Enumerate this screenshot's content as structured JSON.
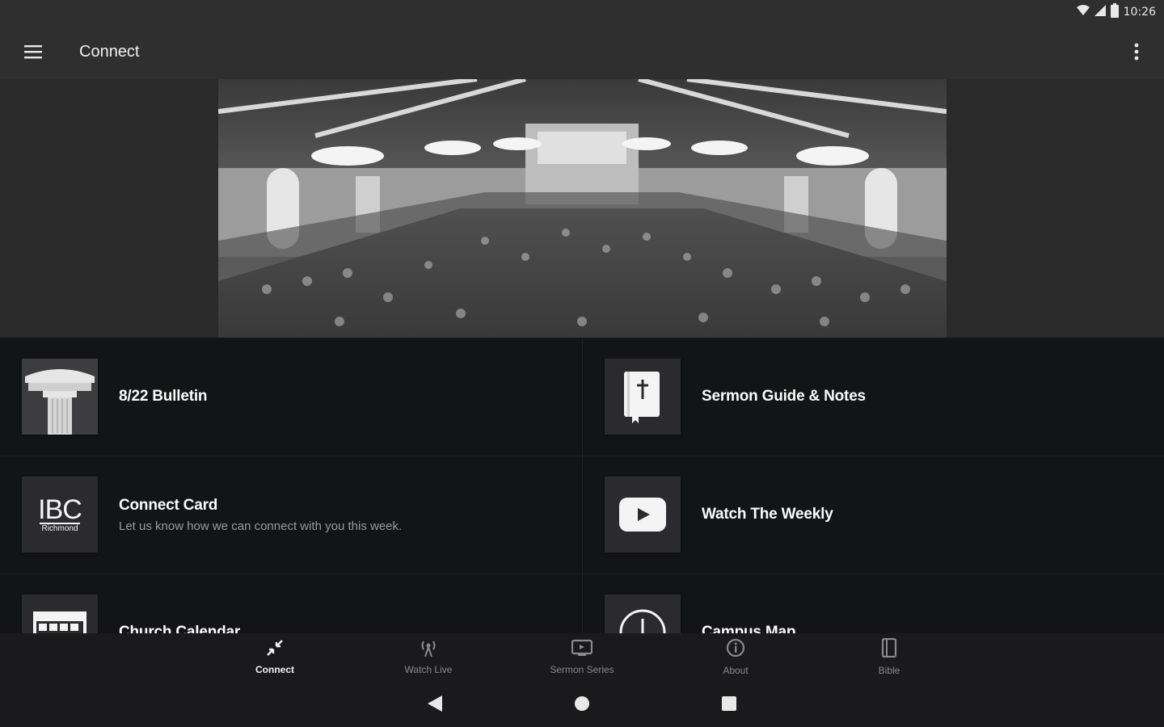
{
  "status_bar": {
    "time": "10:26",
    "wifi_icon": "wifi-icon",
    "signal_icon": "cell-signal-icon",
    "battery_icon": "battery-icon"
  },
  "toolbar": {
    "title": "Connect",
    "menu_icon": "hamburger-menu-icon",
    "overflow_icon": "more-vertical-icon"
  },
  "hero": {
    "description_icon": "sanctuary-photo"
  },
  "tiles": [
    {
      "label": "8/22 Bulletin",
      "subtitle": "",
      "icon": "column-building-icon"
    },
    {
      "label": "Sermon Guide & Notes",
      "subtitle": "",
      "icon": "bible-icon"
    },
    {
      "label": "Connect Card",
      "subtitle": "Let us know how we can connect with you this week.",
      "icon": "ibc-logo",
      "logo_main": "IBC",
      "logo_sub": "Richmond"
    },
    {
      "label": "Watch The Weekly",
      "subtitle": "",
      "icon": "play-button-icon"
    },
    {
      "label": "Church Calendar",
      "subtitle": "",
      "icon": "calendar-icon"
    },
    {
      "label": "Campus Map",
      "subtitle": "",
      "icon": "compass-icon"
    }
  ],
  "bottom_nav": [
    {
      "label": "Connect",
      "icon": "connect-arrows-icon",
      "active": true
    },
    {
      "label": "Watch Live",
      "icon": "broadcast-icon",
      "active": false
    },
    {
      "label": "Sermon Series",
      "icon": "tv-icon",
      "active": false
    },
    {
      "label": "About",
      "icon": "info-icon",
      "active": false
    },
    {
      "label": "Bible",
      "icon": "book-icon",
      "active": false
    }
  ],
  "system_nav": {
    "back": "back-icon",
    "home": "home-icon",
    "recents": "recents-icon"
  },
  "colors": {
    "toolbar": "#2f2f2f",
    "grid_bg": "#131416",
    "tile_thumb": "#2b2b2d",
    "active_label": "#f2f2f2",
    "inactive_label": "#8a8a8a"
  }
}
